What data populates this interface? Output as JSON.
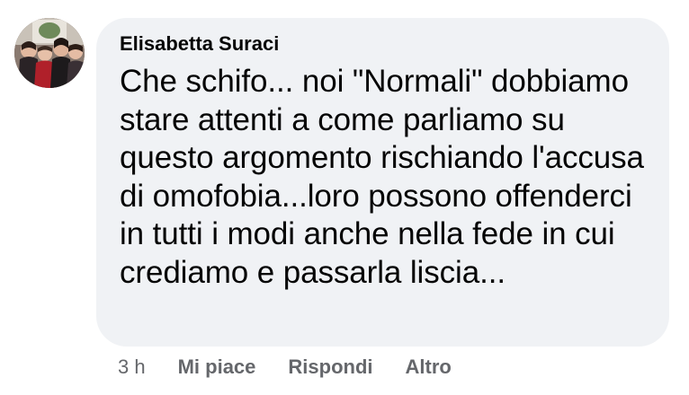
{
  "comment": {
    "author": "Elisabetta Suraci",
    "text": "Che schifo... noi \"Normali\" dobbiamo stare attenti a come parliamo su questo argomento rischiando l'accusa di omofobia...loro possono offenderci in tutti i modi anche nella fede in cui crediamo e passarla liscia...",
    "timestamp": "3 h",
    "actions": {
      "like": "Mi piace",
      "reply": "Rispondi",
      "more": "Altro"
    }
  },
  "colors": {
    "bubble_bg": "#f0f2f5",
    "text": "#050505",
    "secondary_text": "#65676b"
  },
  "icons": {
    "avatar": "profile-photo"
  }
}
